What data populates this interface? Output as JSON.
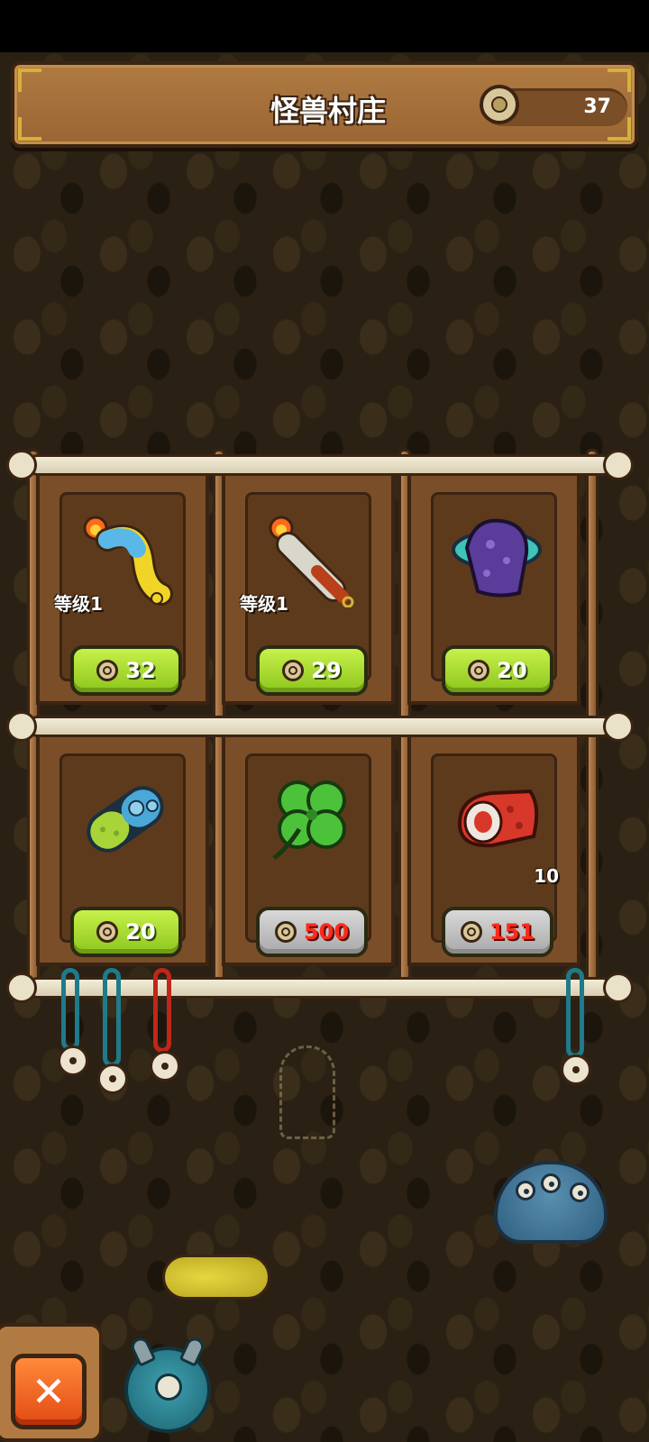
{
  "header": {
    "title": "怪兽村庄",
    "coins": "37"
  },
  "shop": {
    "items": [
      {
        "name": "flaming-worm-icon",
        "level": "等级1",
        "price": "32",
        "button_color": "green"
      },
      {
        "name": "flaming-bone-club-icon",
        "level": "等级1",
        "price": "29",
        "button_color": "green"
      },
      {
        "name": "purple-fungus-icon",
        "level": "",
        "price": "20",
        "button_color": "green"
      },
      {
        "name": "green-capsule-icon",
        "level": "",
        "price": "20",
        "button_color": "green"
      },
      {
        "name": "four-leaf-clover-icon",
        "level": "",
        "price": "500",
        "button_color": "gray"
      },
      {
        "name": "raw-meat-icon",
        "level": "",
        "quantity": "10",
        "price": "151",
        "button_color": "gray"
      }
    ]
  },
  "controls": {
    "close": "✕"
  },
  "colors": {
    "affordable_button": "#9bd22a",
    "unaffordable_button": "#b5b5b5",
    "unaffordable_price_text": "#ff2a1a",
    "close_button": "#f06a24"
  }
}
